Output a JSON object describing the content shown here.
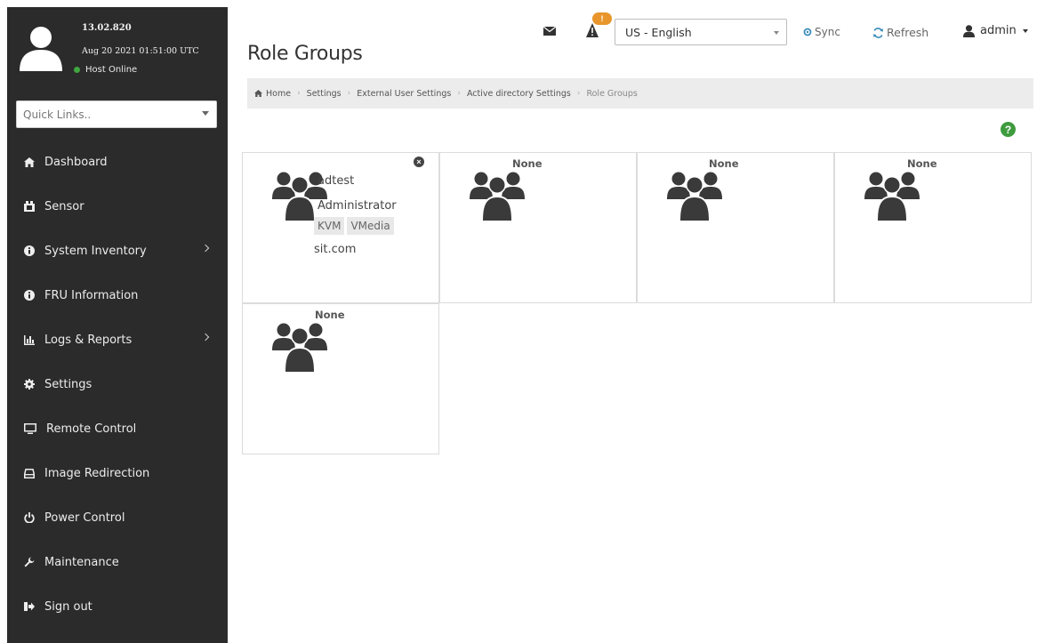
{
  "sidebar": {
    "profile": {
      "version": "13.02.820",
      "datetime": "Aug 20 2021 01:51:00 UTC",
      "status": "Host Online"
    },
    "quick_links": {
      "placeholder": "Quick Links.."
    },
    "items": [
      {
        "label": "Dashboard",
        "icon": "dashboard-icon",
        "has_submenu": false
      },
      {
        "label": "Sensor",
        "icon": "sensor-icon",
        "has_submenu": false
      },
      {
        "label": "System Inventory",
        "icon": "info-icon",
        "has_submenu": true
      },
      {
        "label": "FRU Information",
        "icon": "info-icon",
        "has_submenu": false
      },
      {
        "label": "Logs & Reports",
        "icon": "bar-chart-icon",
        "has_submenu": true
      },
      {
        "label": "Settings",
        "icon": "gear-icon",
        "has_submenu": false
      },
      {
        "label": "Remote Control",
        "icon": "monitor-icon",
        "has_submenu": false
      },
      {
        "label": "Image Redirection",
        "icon": "drive-icon",
        "has_submenu": false
      },
      {
        "label": "Power Control",
        "icon": "power-icon",
        "has_submenu": false
      },
      {
        "label": "Maintenance",
        "icon": "wrench-icon",
        "has_submenu": false
      },
      {
        "label": "Sign out",
        "icon": "sign-out-icon",
        "has_submenu": false
      }
    ]
  },
  "topbar": {
    "alert_count": "!",
    "language": "US - English",
    "sync_label": "Sync",
    "refresh_label": "Refresh",
    "user_label": "admin"
  },
  "page": {
    "title": "Role Groups",
    "breadcrumb": [
      "Home",
      "Settings",
      "External User Settings",
      "Active directory Settings",
      "Role Groups"
    ]
  },
  "role_groups": [
    {
      "name": "adtest",
      "privilege": "Administrator",
      "extended_privileges": [
        "KVM",
        "VMedia"
      ],
      "domain": "sit.com"
    },
    {
      "name": "None"
    },
    {
      "name": "None"
    },
    {
      "name": "None"
    },
    {
      "name": "None"
    }
  ],
  "colors": {
    "sidebar_bg": "#2b2b2b",
    "accent": "#3c8dbc",
    "status_online": "#3fa63f",
    "alert_badge": "#e8962c",
    "help": "#3e9b3e"
  }
}
